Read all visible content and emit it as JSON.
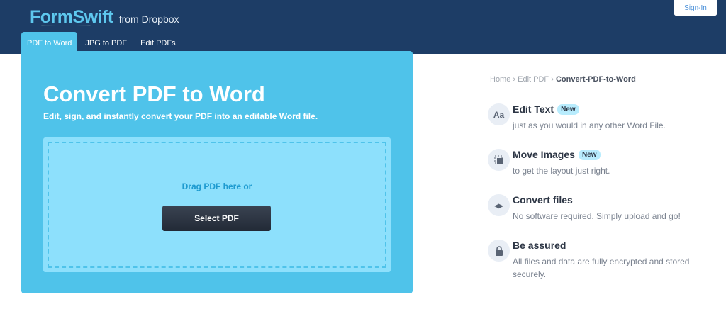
{
  "header": {
    "logo": "FormSwift",
    "logo_sub": "from Dropbox",
    "signin": "Sign-In",
    "tabs": [
      {
        "label": "PDF to Word"
      },
      {
        "label": "JPG to PDF"
      },
      {
        "label": "Edit PDFs"
      }
    ]
  },
  "hero": {
    "title": "Convert PDF to Word",
    "subtitle": "Edit, sign, and instantly convert your PDF into an editable Word file.",
    "drag_text": "Drag PDF here or",
    "select_label": "Select PDF"
  },
  "breadcrumb": {
    "home": "Home",
    "sep": "›",
    "edit": "Edit PDF",
    "current": "Convert-PDF-to-Word"
  },
  "features": [
    {
      "icon": "Aa",
      "title": "Edit Text",
      "badge": "New",
      "desc": "just as you would in any other Word File."
    },
    {
      "icon": "move-image-icon",
      "title": "Move Images",
      "badge": "New",
      "desc": "to get the layout just right."
    },
    {
      "icon": "arrows-icon",
      "title": "Convert files",
      "desc": "No software required. Simply upload and go!"
    },
    {
      "icon": "lock-icon",
      "title": "Be assured",
      "desc": "All files and data are fully encrypted and stored securely."
    }
  ]
}
